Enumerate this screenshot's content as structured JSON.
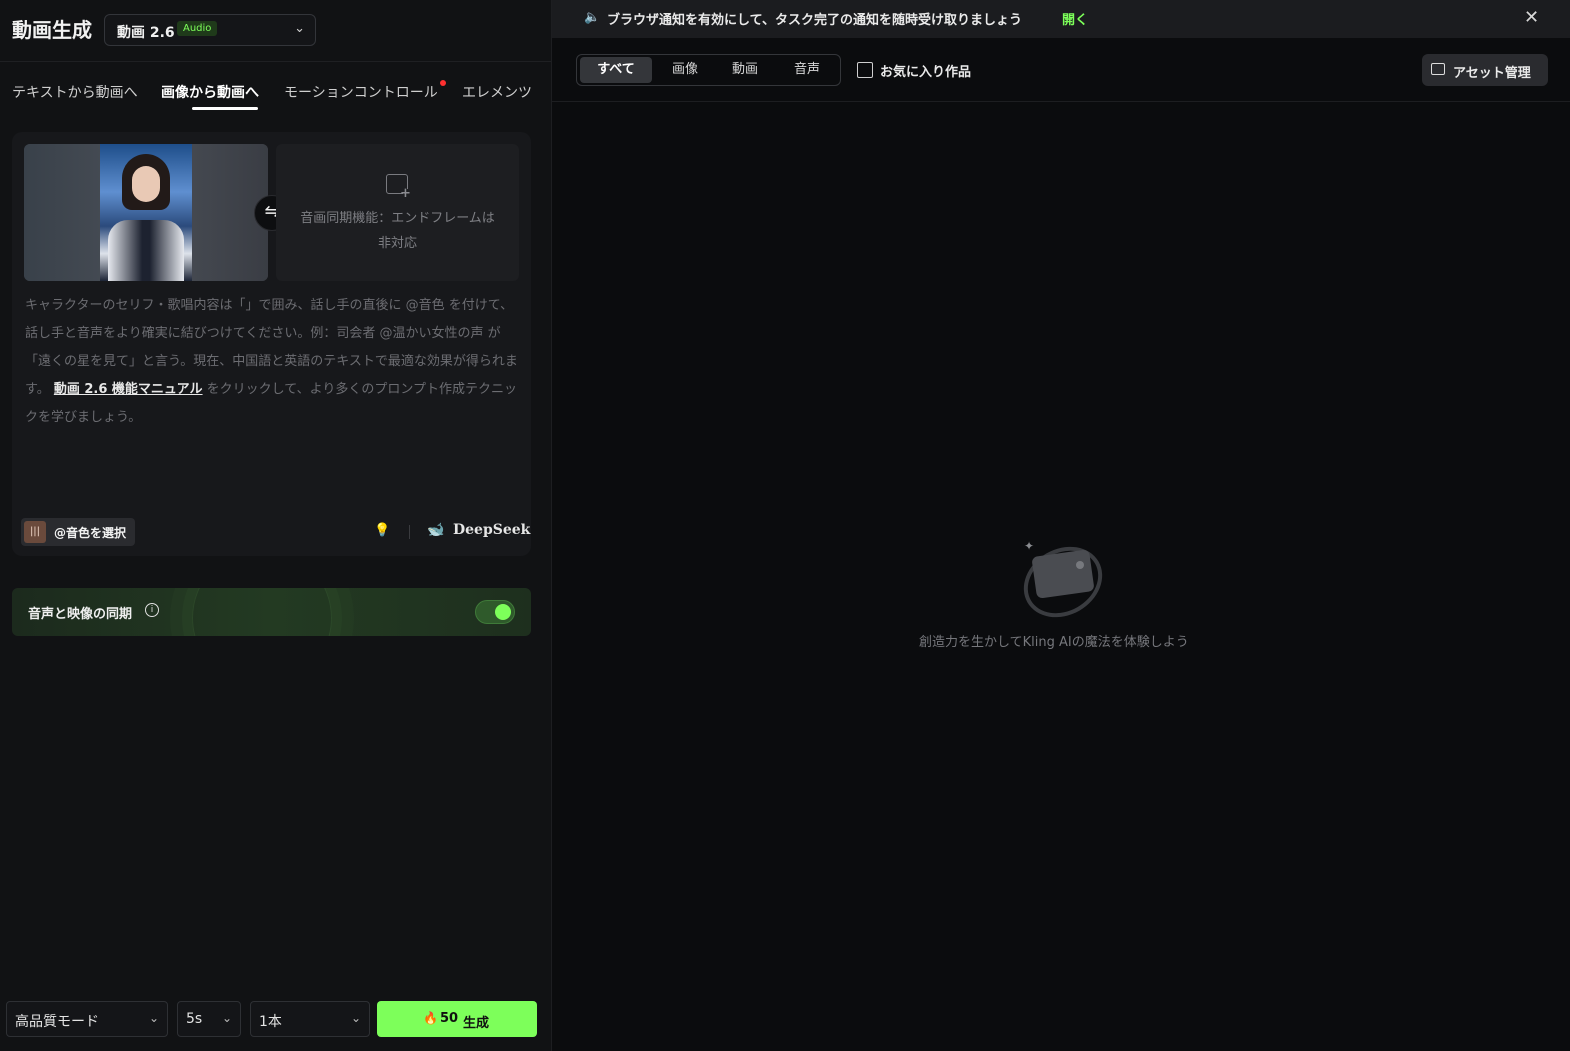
{
  "header": {
    "title": "動画生成",
    "model": {
      "name": "動画 2.6",
      "badge": "Audio"
    }
  },
  "tabs": [
    {
      "label": "テキストから動画へ"
    },
    {
      "label": "画像から動画へ",
      "active": true
    },
    {
      "label": "モーションコントロール",
      "has_dot": true
    },
    {
      "label": "エレメンツ"
    }
  ],
  "frames": {
    "swap_symbol": "⇋",
    "end_frame_text": "音画同期機能：エンドフレームは非対応"
  },
  "prompt": {
    "before_link": "キャラクターのセリフ・歌唱内容は「」で囲み、話し手の直後に @音色 を付けて、話し手と音声をより確実に結びつけてください。例：司会者 @温かい女性の声 が「遠くの星を見て」と言う。現在、中国語と英語のテキストで最適な効果が得られます。 ",
    "link": "動画 2.6 機能マニュアル",
    "after_link": " をクリックして、より多くのプロンプト作成テクニックを学びましょう。"
  },
  "toolbar": {
    "voice_label": "@音色を選択",
    "deepseek_label": "DeepSeek"
  },
  "sync": {
    "label": "音声と映像の同期",
    "enabled": true
  },
  "bottom": {
    "mode": "高品質モード",
    "duration": "5s",
    "count": "1本",
    "credits": "50",
    "generate_label": "生成"
  },
  "notice": {
    "text": "ブラウザ通知を有効にして、タスク完了の通知を随時受け取りましょう",
    "action": "開く"
  },
  "filters": {
    "all": "すべて",
    "image": "画像",
    "video": "動画",
    "audio": "音声",
    "favorites": "お気に入り作品"
  },
  "asset_button": "アセット管理",
  "empty_state": "創造力を生かしてKling AIの魔法を体験しよう",
  "colors": {
    "accent": "#7dff5a",
    "background": "#0b0c0e",
    "panel": "#111214"
  }
}
